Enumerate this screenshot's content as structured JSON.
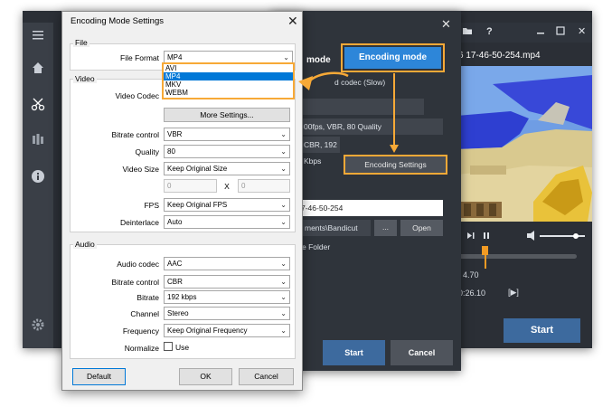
{
  "main_app": {
    "video_title": "6 17-46-50-254.mp4",
    "time_small": "4.70",
    "time_big": "0:26.10",
    "time_controls": "[▶]",
    "start_label": "Start"
  },
  "settings_window": {
    "mode_label": "mode",
    "encoding_mode_button": "Encoding mode",
    "codec_text": "d codec (Slow)",
    "info_row1": "00fps, VBR, 80 Quality",
    "info_row2": "CBR, 192 Kbps",
    "encoding_settings_button": "Encoding Settings",
    "filename": "7-46-50-254",
    "folder_path": "ments\\Bandicut",
    "dots_button": "...",
    "open_button": "Open",
    "folder_label": "e Folder",
    "start_label": "Start",
    "cancel_label": "Cancel"
  },
  "dialog": {
    "title": "Encoding Mode Settings",
    "close": "✕",
    "file_group": {
      "label": "File",
      "file_format_label": "File Format",
      "file_format_value": "MP4",
      "options": [
        "AVI",
        "MP4",
        "MKV",
        "WEBM"
      ],
      "selected_index": 1
    },
    "video_group": {
      "label": "Video",
      "video_codec_label": "Video Codec",
      "more_settings": "More Settings...",
      "bitrate_control_label": "Bitrate control",
      "bitrate_control_value": "VBR",
      "quality_label": "Quality",
      "quality_value": "80",
      "video_size_label": "Video Size",
      "video_size_value": "Keep Original Size",
      "width_value": "0",
      "x_label": "X",
      "height_value": "0",
      "fps_label": "FPS",
      "fps_value": "Keep Original FPS",
      "deinterlace_label": "Deinterlace",
      "deinterlace_value": "Auto"
    },
    "audio_group": {
      "label": "Audio",
      "audio_codec_label": "Audio codec",
      "audio_codec_value": "AAC",
      "bitrate_control_label": "Bitrate control",
      "bitrate_control_value": "CBR",
      "bitrate_label": "Bitrate",
      "bitrate_value": "192 kbps",
      "channel_label": "Channel",
      "channel_value": "Stereo",
      "frequency_label": "Frequency",
      "frequency_value": "Keep Original Frequency",
      "normalize_label": "Normalize",
      "use_label": "Use"
    },
    "default_button": "Default",
    "ok_button": "OK",
    "cancel_button": "Cancel"
  },
  "colors": {
    "accent_orange": "#f7a937",
    "selection_blue": "#0078d7",
    "encoding_mode_blue": "#2d86d9",
    "start_blue": "#3d6a9e"
  },
  "icons": {
    "sidebar": [
      "menu-icon",
      "home-icon",
      "cut-icon",
      "bar-icon",
      "info-icon",
      "gear-icon"
    ],
    "titlebar": [
      "folder-icon",
      "help-icon",
      "minimize-icon",
      "maximize-icon",
      "close-icon"
    ]
  }
}
